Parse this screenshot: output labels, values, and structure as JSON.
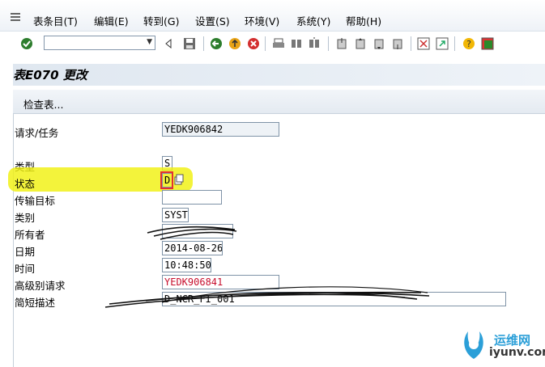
{
  "menu": [
    "表条目(T)",
    "编辑(E)",
    "转到(G)",
    "设置(S)",
    "环境(V)",
    "系统(Y)",
    "帮助(H)"
  ],
  "toolbar": {
    "command_value": "",
    "icons": [
      "ok-check",
      "command-field",
      "back",
      "save",
      "back-green",
      "exit",
      "cancel",
      "print",
      "find",
      "find-next",
      "first-page",
      "prev-page",
      "next-page",
      "last-page",
      "create-session",
      "shortcut",
      "help",
      "customize"
    ]
  },
  "title": "表E070 更改",
  "app_toolbar": {
    "check_table": "检查表..."
  },
  "form": {
    "request_label": "请求/任务",
    "request_value": "YEDK906842",
    "type_label": "类型",
    "type_value": "S",
    "status_label": "状态",
    "status_value": "D",
    "target_label": "传输目标",
    "target_value": "",
    "category_label": "类别",
    "category_value": "SYST",
    "owner_label": "所有者",
    "owner_value": "",
    "date_label": "日期",
    "date_value": "2014-08-26",
    "time_label": "时间",
    "time_value": "10:48:50",
    "parent_label": "高级别请求",
    "parent_value": "YEDK906841",
    "desc_label": "简短描述",
    "desc_value": "D_NCR_FI_001"
  },
  "watermark": {
    "cn": "运维网",
    "url": "iyunv.com"
  },
  "colors": {
    "highlight": "#f0f010",
    "red_text": "#c8102e",
    "title_bg": "#dfe7f0"
  }
}
